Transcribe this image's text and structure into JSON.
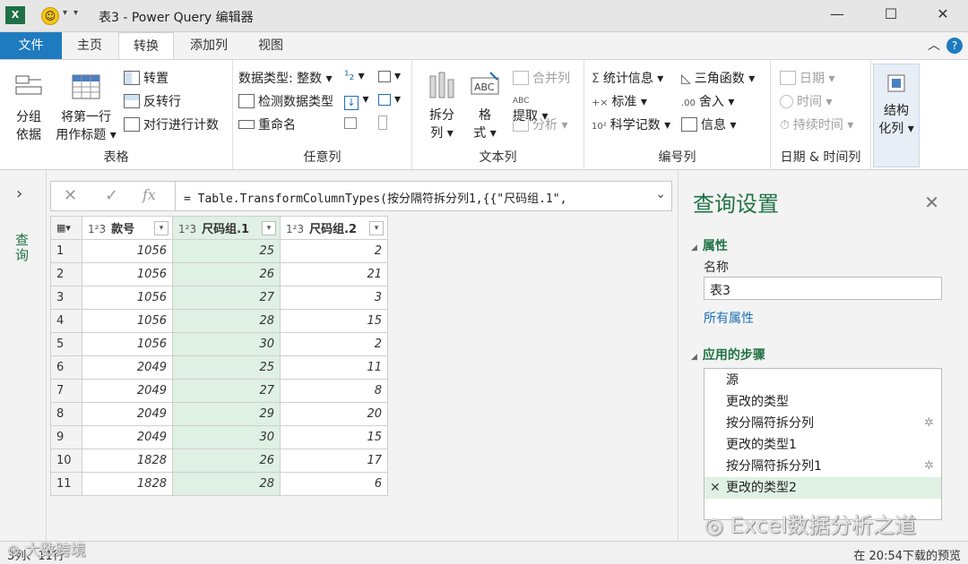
{
  "window": {
    "title": "表3 - Power Query 编辑器",
    "app_badge": "X"
  },
  "tabs": [
    {
      "label": "文件"
    },
    {
      "label": "主页"
    },
    {
      "label": "转换"
    },
    {
      "label": "添加列"
    },
    {
      "label": "视图"
    }
  ],
  "ribbon": {
    "table_group": {
      "label": "表格",
      "group_by": [
        "分组",
        "依据"
      ],
      "first_row_header": [
        "将第一行",
        "用作标题"
      ],
      "transpose": "转置",
      "reverse_rows": "反转行",
      "count_rows": "对行进行计数"
    },
    "any_column_group": {
      "label": "任意列",
      "data_type": "数据类型: 整数",
      "detect_type": "检测数据类型",
      "rename": "重命名"
    },
    "text_column_group": {
      "label": "文本列",
      "split_column": [
        "拆分",
        "列"
      ],
      "format": [
        "格",
        "式"
      ],
      "merge_columns": "合并列",
      "extract": "提取",
      "parse": "分析"
    },
    "number_column_group": {
      "label": "编号列",
      "statistics": "统计信息",
      "standard": "标准",
      "scientific": "科学记数",
      "trigonometry": "三角函数",
      "rounding": "舍入",
      "information": "信息"
    },
    "datetime_group": {
      "label": "日期 & 时间列",
      "date": "日期",
      "time": "时间",
      "duration": "持续时间"
    },
    "structured_group": {
      "structured_column": [
        "结构",
        "化列"
      ]
    }
  },
  "left_pane": {
    "label": "查询"
  },
  "formula_bar": {
    "formula": "= Table.TransformColumnTypes(按分隔符拆分列1,{{\"尺码组.1\",",
    "fx": "fx"
  },
  "grid": {
    "columns": [
      {
        "type": "1²3",
        "name": "款号"
      },
      {
        "type": "1²3",
        "name": "尺码组.1"
      },
      {
        "type": "1²3",
        "name": "尺码组.2"
      }
    ],
    "rows": [
      [
        "1",
        "1056",
        "25",
        "2"
      ],
      [
        "2",
        "1056",
        "26",
        "21"
      ],
      [
        "3",
        "1056",
        "27",
        "3"
      ],
      [
        "4",
        "1056",
        "28",
        "15"
      ],
      [
        "5",
        "1056",
        "30",
        "2"
      ],
      [
        "6",
        "2049",
        "25",
        "11"
      ],
      [
        "7",
        "2049",
        "27",
        "8"
      ],
      [
        "8",
        "2049",
        "29",
        "20"
      ],
      [
        "9",
        "2049",
        "30",
        "15"
      ],
      [
        "10",
        "1828",
        "26",
        "17"
      ],
      [
        "11",
        "1828",
        "28",
        "6"
      ]
    ]
  },
  "query_settings": {
    "title": "查询设置",
    "properties_header": "属性",
    "name_label": "名称",
    "name_value": "表3",
    "all_properties": "所有属性",
    "applied_steps_header": "应用的步骤",
    "steps": [
      "源",
      "更改的类型",
      "按分隔符拆分列",
      "更改的类型1",
      "按分隔符拆分列1",
      "更改的类型2"
    ]
  },
  "status": {
    "left": "3列、11行",
    "right": "在 20:54下载的预览"
  },
  "watermarks": {
    "wechat": "Excel数据分析之道",
    "corner": "大数跨境"
  },
  "colors": {
    "accent": "#217346",
    "file_tab": "#1e7bbf",
    "selected": "#dff0e5"
  }
}
